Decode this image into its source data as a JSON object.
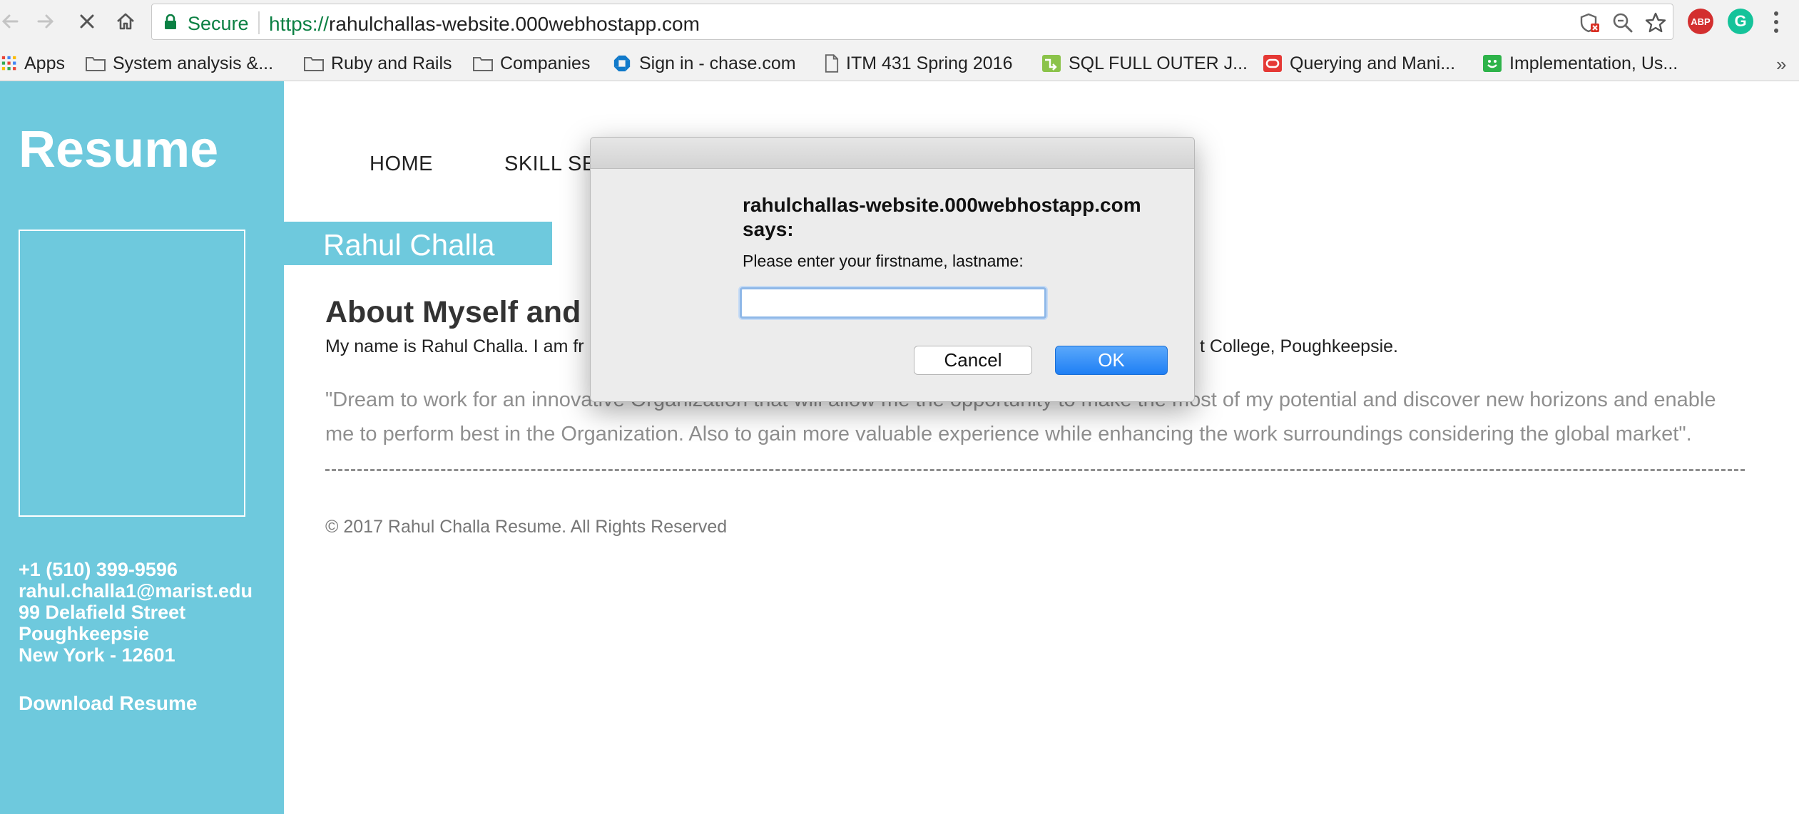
{
  "browser": {
    "nav": {
      "back_icon": "back-arrow-icon",
      "forward_icon": "forward-arrow-icon",
      "stop_icon": "stop-loading-icon",
      "home_icon": "home-icon"
    },
    "omnibox": {
      "secure_label": "Secure",
      "url_scheme": "https://",
      "url_host": "rahulchallas-website.000webhostapp.com",
      "secure_color": "#0b8043"
    },
    "extensions": {
      "abp_label": "ABP",
      "grammarly_label": "G"
    }
  },
  "bookmarks": [
    {
      "label": "Apps",
      "icon": "apps-grid-icon"
    },
    {
      "label": "System analysis &...",
      "icon": "folder-icon"
    },
    {
      "label": "Ruby and Rails",
      "icon": "folder-icon"
    },
    {
      "label": "Companies",
      "icon": "folder-icon"
    },
    {
      "label": "Sign in - chase.com",
      "icon": "chase-logo-icon"
    },
    {
      "label": "ITM 431 Spring 2016",
      "icon": "page-icon"
    },
    {
      "label": "SQL FULL OUTER J...",
      "icon": "sql-site-icon"
    },
    {
      "label": "Querying and Mani...",
      "icon": "oracle-icon"
    },
    {
      "label": "Implementation, Us...",
      "icon": "smiley-site-icon"
    }
  ],
  "bookmarks_more": "»",
  "page": {
    "sidebar": {
      "title": "Resume",
      "contact": {
        "phone": "+1 (510) 399-9596",
        "email": "rahul.challa1@marist.edu",
        "street": "99 Delafield Street",
        "city": "Poughkeepsie",
        "state_zip": "New York - 12601"
      },
      "download_label": "Download Resume",
      "accent_color": "#6ec9dd"
    },
    "nav": {
      "home": "HOME",
      "skill": "SKILL SE"
    },
    "name_banner": "Rahul Challa",
    "about": {
      "heading": "About Myself and",
      "text_start": "My name is Rahul Challa. I am fr",
      "text_end": "t College, Poughkeepsie."
    },
    "quote": "\"Dream to work for an innovative Organization that will allow me the opportunity to make the most of my potential and discover new horizons and enable me to perform best in the Organization. Also to gain more valuable experience while enhancing the work surroundings considering the global market\".",
    "footer": "© 2017 Rahul Challa Resume. All Rights Reserved"
  },
  "dialog": {
    "title": "rahulchallas-website.000webhostapp.com says:",
    "message": "Please enter your firstname, lastname:",
    "input_value": "",
    "cancel_label": "Cancel",
    "ok_label": "OK",
    "ok_color": "#1f7ff4"
  }
}
